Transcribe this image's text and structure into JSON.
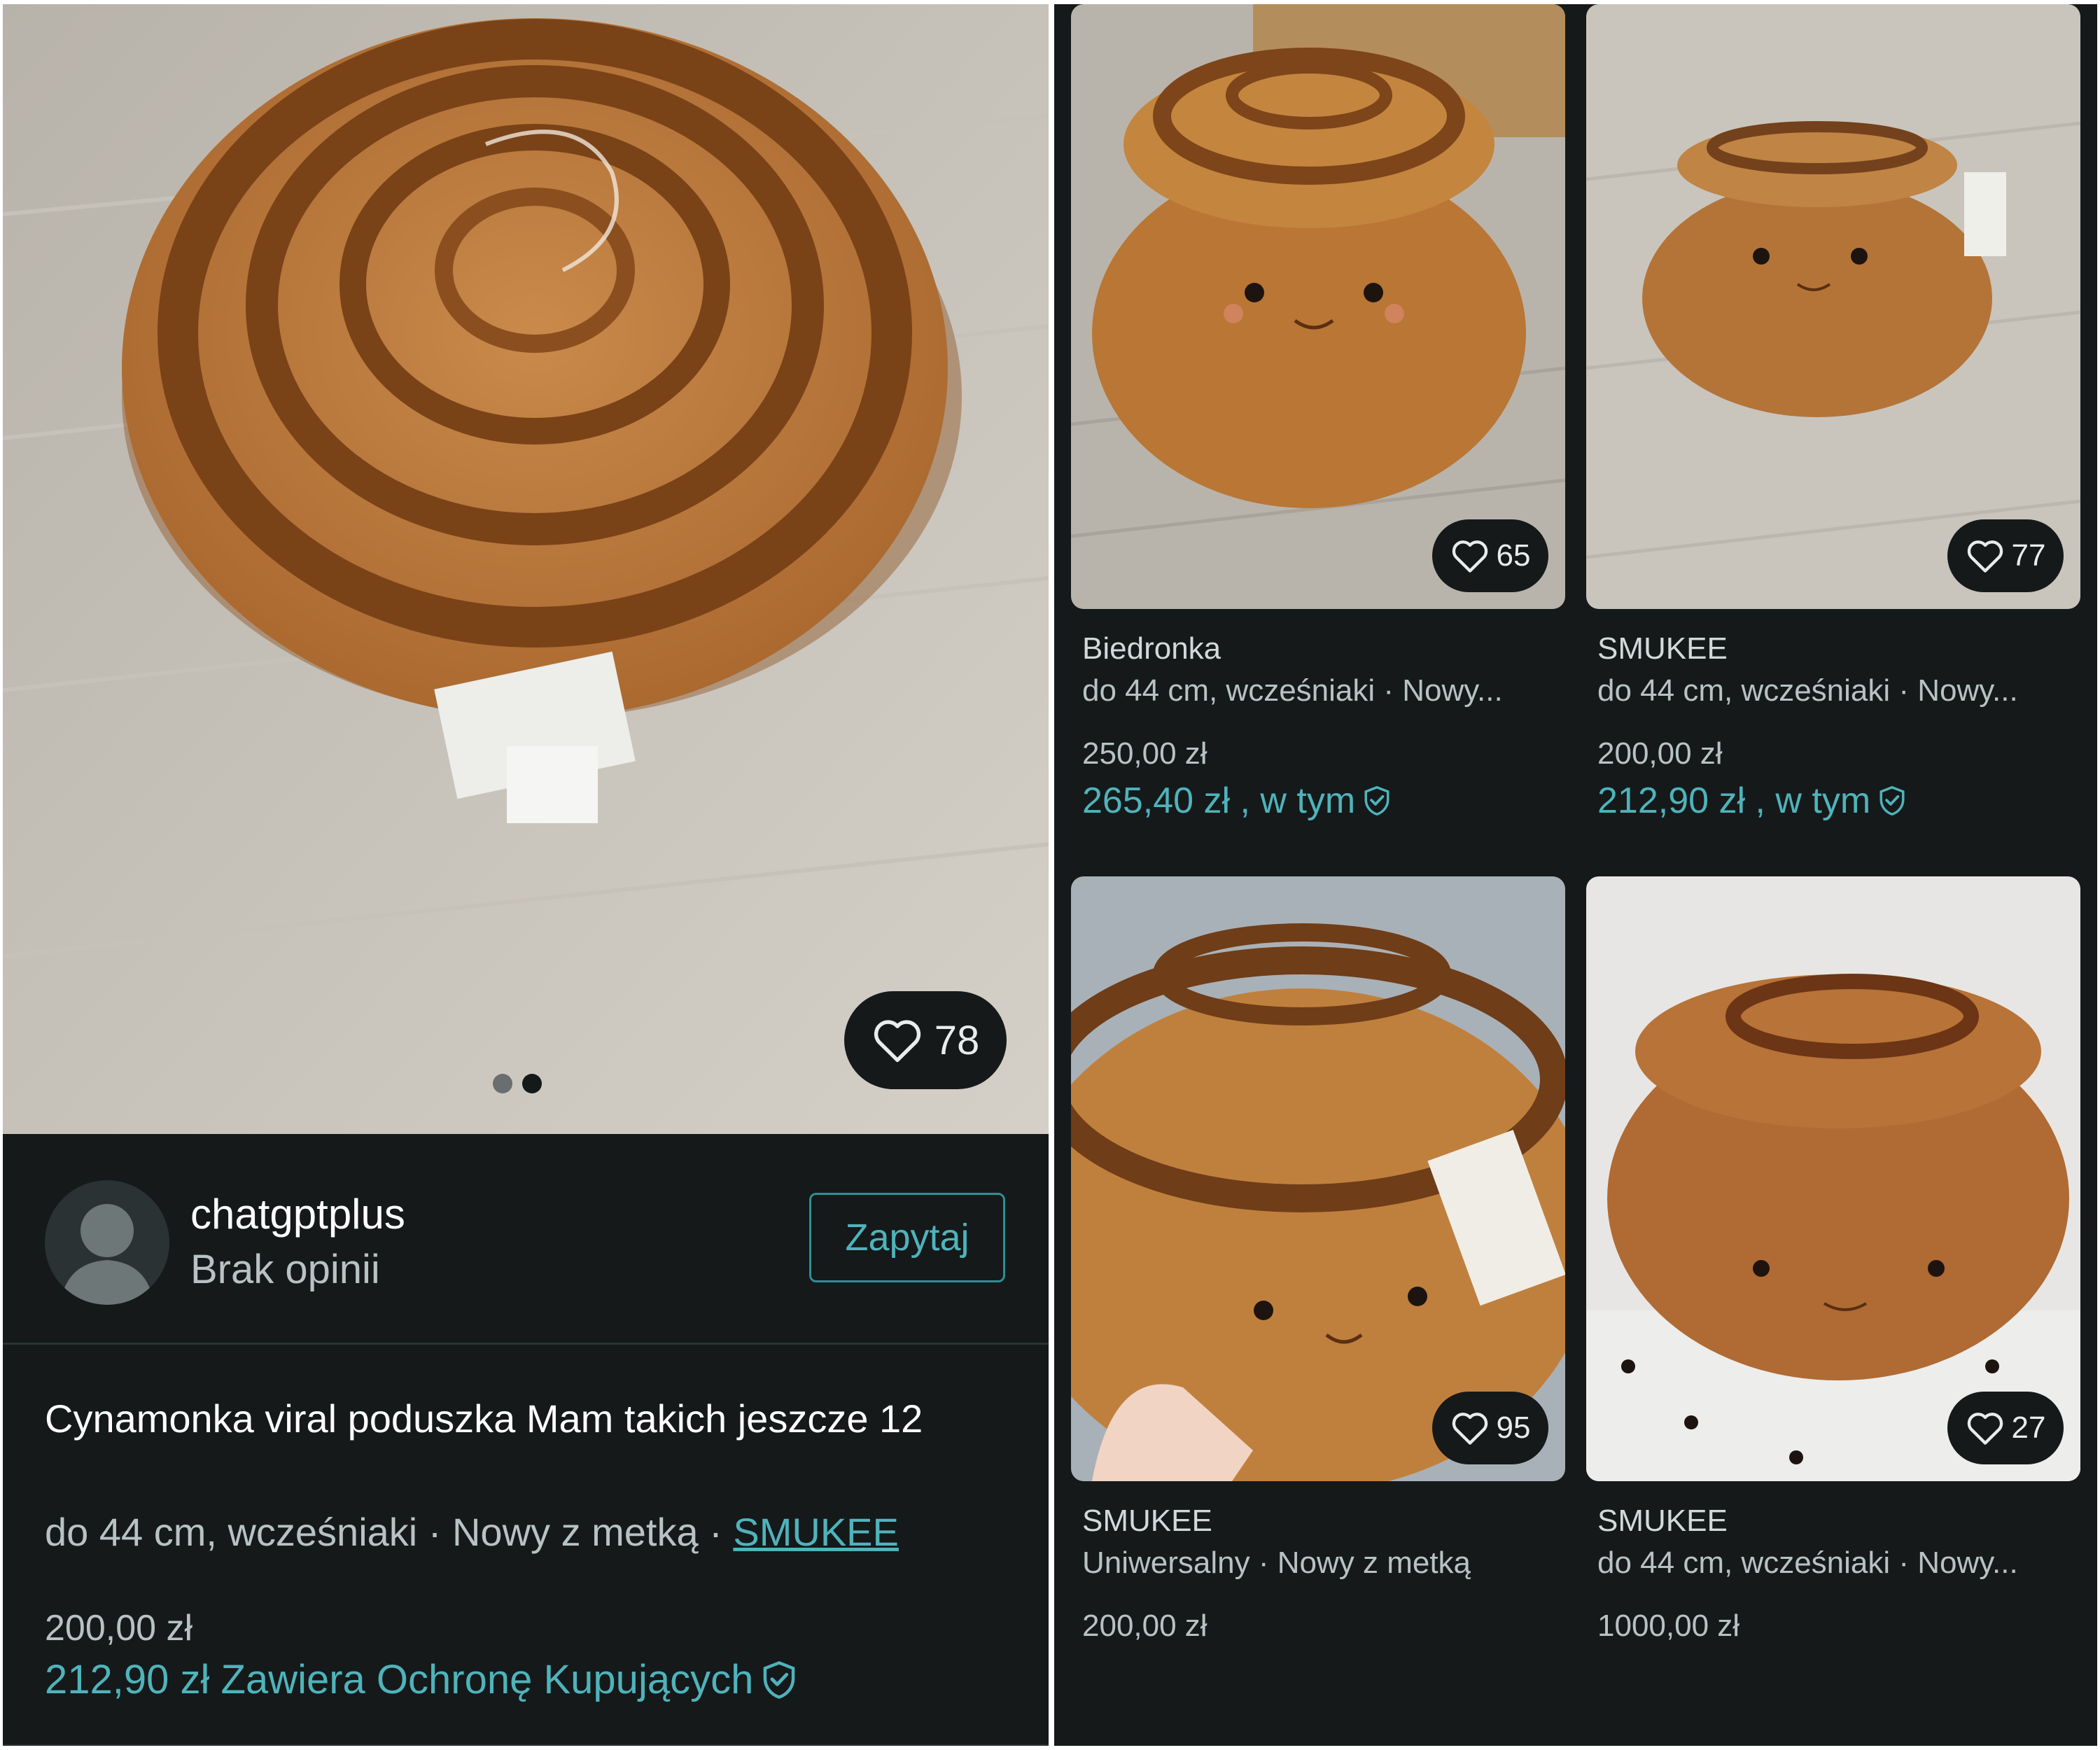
{
  "listing": {
    "likes": "78",
    "seller": {
      "name": "chatgptplus",
      "rating": "Brak opinii"
    },
    "ask_button": "Zapytaj",
    "title": "Cynamonka viral poduszka Mam takich jeszcze 12",
    "meta_prefix": "do 44 cm, wcześniaki · Nowy z metką · ",
    "brand": "SMUKEE",
    "price": "200,00 zł",
    "total_price": "212,90 zł Zawiera Ochronę Kupujących",
    "photo_dots": 2,
    "active_dot": 2
  },
  "grid": [
    {
      "likes": "65",
      "brand": "Biedronka",
      "meta": "do 44 cm, wcześniaki · Nowy...",
      "price": "250,00 zł",
      "total": "265,40 zł , w tym"
    },
    {
      "likes": "77",
      "brand": "SMUKEE",
      "meta": "do 44 cm, wcześniaki · Nowy...",
      "price": "200,00 zł",
      "total": "212,90 zł , w tym"
    },
    {
      "likes": "95",
      "brand": "SMUKEE",
      "meta": "Uniwersalny · Nowy z metką",
      "price": "200,00 zł"
    },
    {
      "likes": "27",
      "brand": "SMUKEE",
      "meta": "do 44 cm, wcześniaki · Nowy...",
      "price": "1000,00 zł"
    }
  ],
  "colors": {
    "background": "#15191a",
    "accent": "#4fb3bb",
    "text_muted": "#b9c2c3"
  },
  "icons": {
    "favourite": "heart-icon",
    "protection": "shield-check-icon",
    "avatar": "user-silhouette-icon"
  }
}
